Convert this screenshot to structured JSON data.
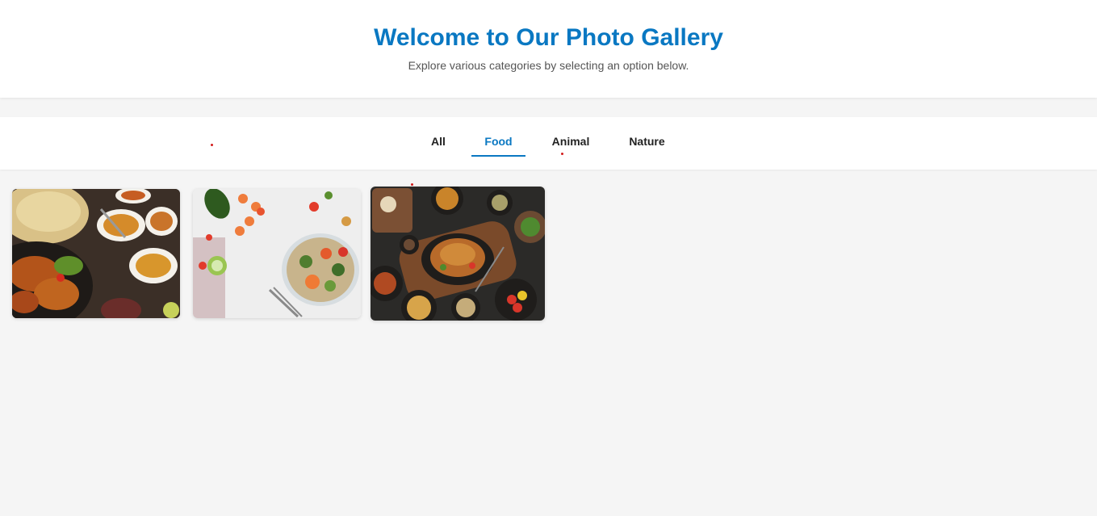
{
  "header": {
    "title": "Welcome to Our Photo Gallery",
    "subtitle": "Explore various categories by selecting an option below."
  },
  "tabs": [
    {
      "label": "All",
      "active": false
    },
    {
      "label": "Food",
      "active": true
    },
    {
      "label": "Animal",
      "active": false
    },
    {
      "label": "Nature",
      "active": false
    }
  ],
  "gallery": {
    "category": "Food",
    "images": [
      {
        "subject": "platter of fried chicken, naan bread and curry bowls"
      },
      {
        "subject": "bowl of roasted vegetables and grains with carrots and tomatoes"
      },
      {
        "subject": "roast chicken on wooden board surrounded by side dishes"
      }
    ]
  },
  "colors": {
    "accent": "#0a78c2",
    "background": "#f5f5f5",
    "panel": "#ffffff",
    "tab_text": "#222222",
    "subtitle_text": "#555555"
  }
}
